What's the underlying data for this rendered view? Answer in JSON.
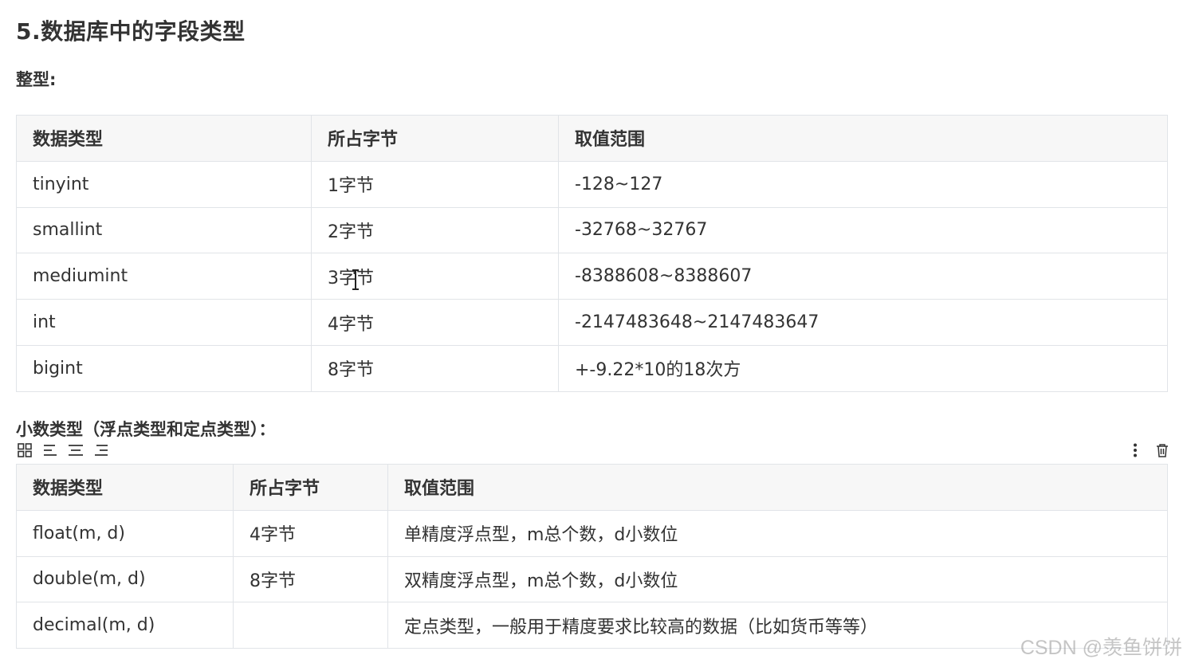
{
  "title": "5.数据库中的字段类型",
  "integer_section": {
    "heading": "整型:",
    "headers": [
      "数据类型",
      "所占字节",
      "取值范围"
    ],
    "rows": [
      [
        "tinyint",
        "1字节",
        "-128~127"
      ],
      [
        "smallint",
        "2字节",
        "-32768~32767"
      ],
      [
        "mediumint",
        "3字节",
        "-8388608~8388607"
      ],
      [
        "int",
        "4字节",
        "-2147483648~2147483647"
      ],
      [
        "bigint",
        "8字节",
        "+-9.22*10的18次方"
      ]
    ]
  },
  "decimal_section": {
    "heading": "小数类型（浮点类型和定点类型）：",
    "headers": [
      "数据类型",
      "所占字节",
      "取值范围"
    ],
    "rows": [
      [
        "float(m, d)",
        "4字节",
        "单精度浮点型，m总个数，d小数位"
      ],
      [
        "double(m, d)",
        "8字节",
        "双精度浮点型，m总个数，d小数位"
      ],
      [
        "decimal(m, d)",
        "",
        "定点类型，一般用于精度要求比较高的数据（比如货币等等）"
      ]
    ]
  },
  "table_toolbar": {
    "left_icons": [
      "grid-icon",
      "align-left-icon",
      "align-center-icon",
      "align-right-icon"
    ],
    "right_icons": [
      "more-vertical-icon",
      "trash-icon"
    ]
  },
  "watermark": "CSDN @羡鱼饼饼"
}
